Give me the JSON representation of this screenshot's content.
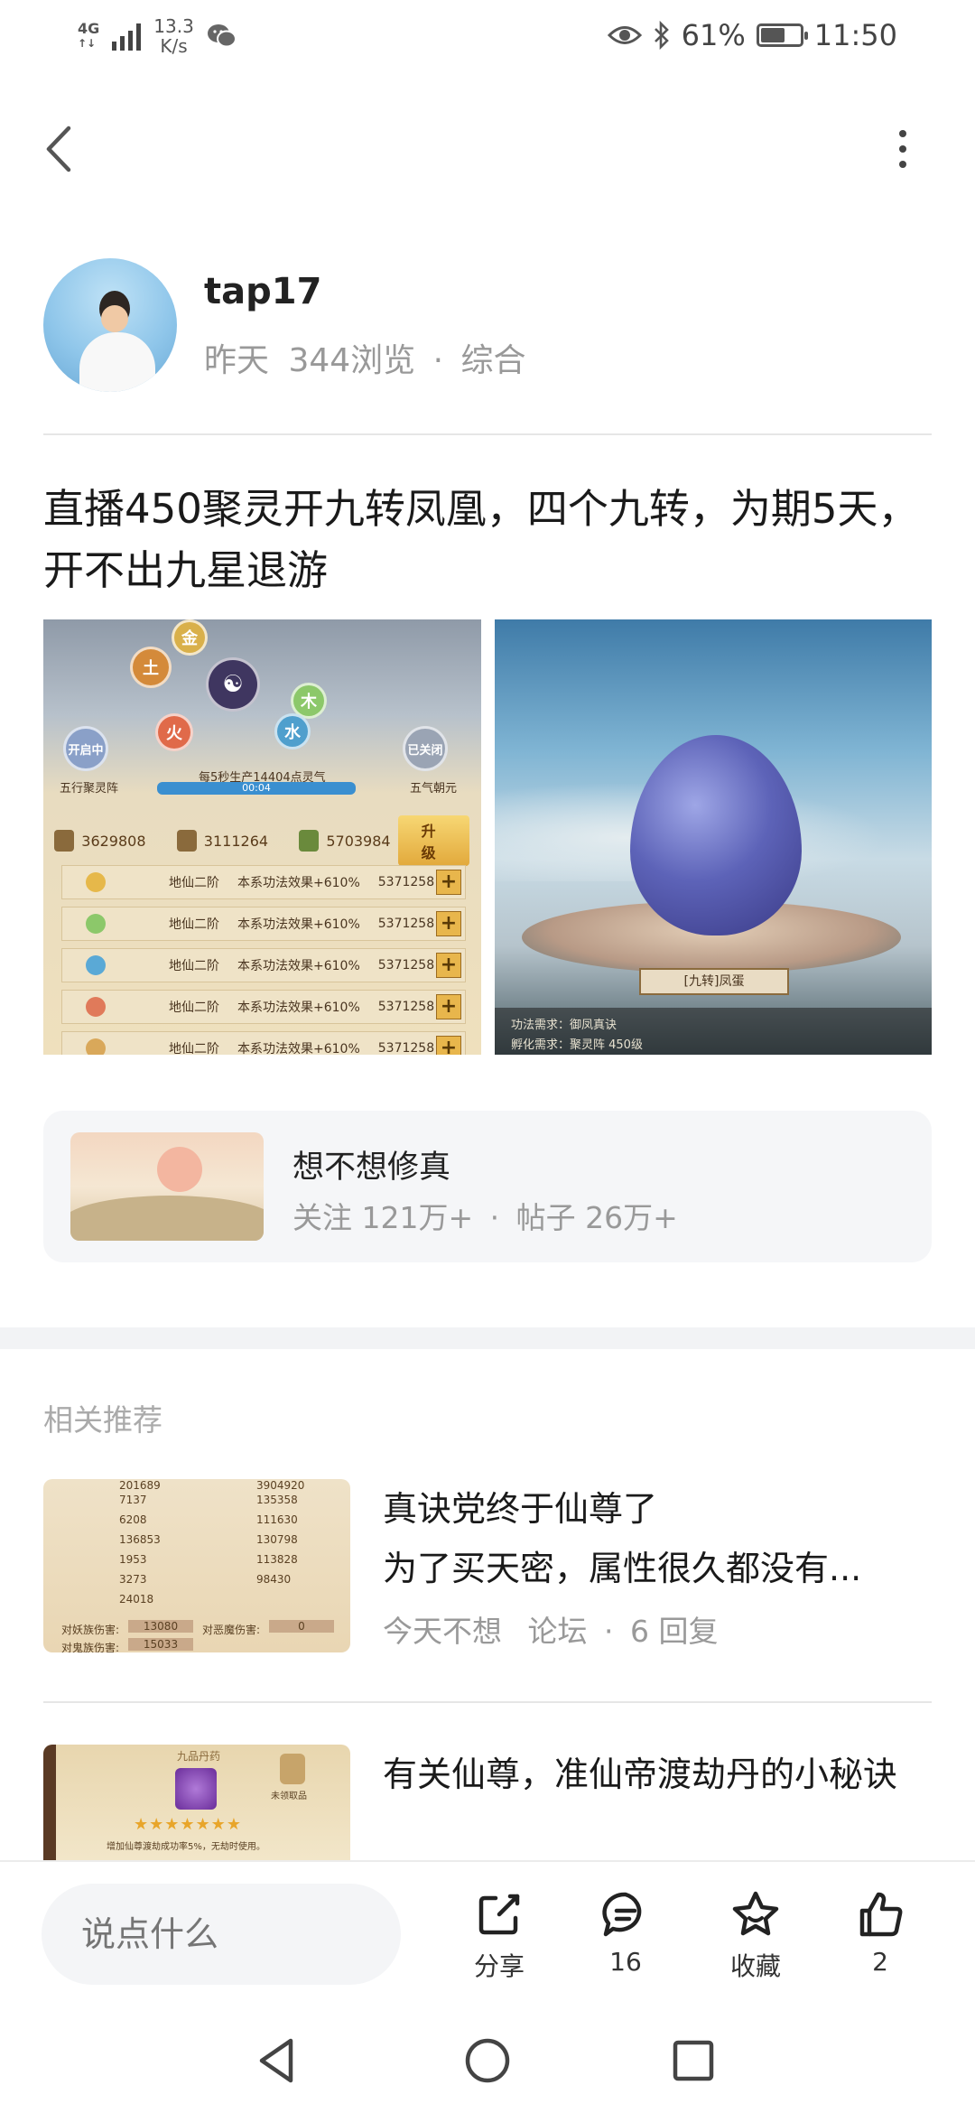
{
  "status_bar": {
    "network": "4G",
    "speed": "13.3",
    "speed_unit": "K/s",
    "battery": "61%",
    "battery_level": 0.61,
    "time": "11:50"
  },
  "post": {
    "author": "tap17",
    "date": "昨天",
    "views": "344浏览",
    "separator": "·",
    "category": "综合",
    "title": "直播450聚灵开九转凤凰，四个九转，为期5天，开不出九星退游"
  },
  "game_screenshot_left": {
    "orbs": [
      "金",
      "土",
      "木",
      "火",
      "水"
    ],
    "left_badge": "开启中",
    "right_badge": "已关闭",
    "left_caption": "五行聚灵阵",
    "right_caption": "五气朝元",
    "production": "每5秒生产14404点灵气",
    "timer": "00:04",
    "resources": [
      "3629808",
      "3111264",
      "5703984"
    ],
    "upgrade": "升级",
    "rows": [
      {
        "color": "#e6b84a",
        "stage": "地仙二阶",
        "effect": "本系功法效果+610%",
        "value": "5371258",
        "plus": "+"
      },
      {
        "color": "#8cc86a",
        "stage": "地仙二阶",
        "effect": "本系功法效果+610%",
        "value": "5371258",
        "plus": "+"
      },
      {
        "color": "#5aa9d6",
        "stage": "地仙二阶",
        "effect": "本系功法效果+610%",
        "value": "5371258",
        "plus": "+"
      },
      {
        "color": "#e07a5a",
        "stage": "地仙二阶",
        "effect": "本系功法效果+610%",
        "value": "5371258",
        "plus": "+"
      },
      {
        "color": "#d9a85a",
        "stage": "地仙二阶",
        "effect": "本系功法效果+610%",
        "value": "5371258",
        "plus": "+"
      }
    ]
  },
  "game_screenshot_right": {
    "egg_label": "[九转]凤蛋",
    "req_line": "功法需求：御凤真诀",
    "req_line2": "孵化需求：聚灵阵 450级"
  },
  "forum": {
    "name": "想不想修真",
    "followers": "关注 121万+",
    "separator": "·",
    "posts": "帖子 26万+"
  },
  "recommend": {
    "heading": "相关推荐",
    "items": [
      {
        "title": "真诀党终于仙尊了",
        "subtitle": "为了买天密，属性很久都没有...",
        "source": "今天不想",
        "board": "论坛",
        "separator": "·",
        "replies": "6 回复",
        "thumb_stats": [
          [
            "7137",
            "135358"
          ],
          [
            "6208",
            "111630"
          ],
          [
            "136853",
            "130798"
          ],
          [
            "1953",
            "113828"
          ],
          [
            "3273",
            "98430"
          ],
          [
            "24018",
            ""
          ]
        ],
        "thumb_top_left": "201689",
        "thumb_top_right": "3904920",
        "thumb_footer1": "对妖族伤害:",
        "thumb_footer1_val": "13080",
        "thumb_footer2": "对恶魔伤害:",
        "thumb_footer2_val": "0",
        "thumb_footer3": "对鬼族伤害:",
        "thumb_footer3_val": "15033"
      },
      {
        "title": "有关仙尊，准仙帝渡劫丹的小秘诀",
        "thumb_header": "九品丹药",
        "thumb_lock": "未领取品",
        "thumb_caption": "增加仙尊渡劫成功率5%，无劫时使用。"
      }
    ]
  },
  "actions": {
    "comment_placeholder": "说点什么",
    "share": "分享",
    "comments": "16",
    "favorite": "收藏",
    "likes": "2"
  },
  "colors": {
    "accent_text": "#222222",
    "muted_text": "#999999",
    "card_bg": "#f5f6f8"
  }
}
